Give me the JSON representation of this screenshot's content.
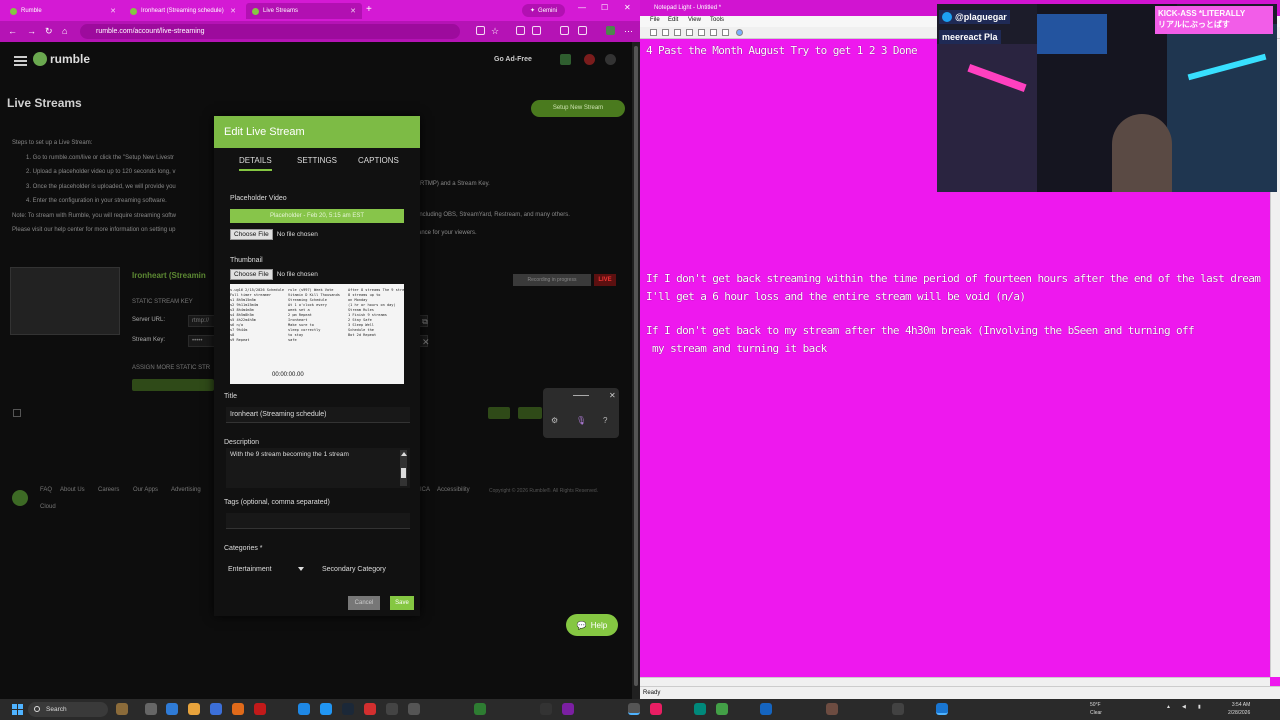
{
  "browser": {
    "tabs": [
      {
        "label": "Rumble"
      },
      {
        "label": "Ironheart (Streaming schedule)"
      },
      {
        "label": "Live Streams"
      }
    ],
    "gemini_label": "Gemini",
    "url": "rumble.com/account/live-streaming"
  },
  "site": {
    "logo_text": "rumble",
    "go_ad_free": "Go Ad-Free",
    "page_title": "Live Streams",
    "setup_button": "Setup New Stream",
    "steps": [
      "Steps to set up a Live Stream:",
      "1. Go to rumble.com/live or click the \"Setup New Livestr",
      "2. Upload a placeholder video up to 120 seconds long, v",
      "3. Once the placeholder is uploaded, we will provide you",
      "4. Enter the configuration in your streaming software.",
      "Note: To stream with Rumble, you will require streaming softw",
      "Please visit our help center for more information on setting up"
    ],
    "steps_right": [
      "(RTMP) and a Stream Key.",
      "including OBS, StreamYard, Restream, and many others.",
      "ance for your viewers."
    ],
    "stream_name": "Ironheart (Streamin",
    "recording_label": "Recording in progress",
    "live_badge": "LIVE",
    "static_key_label": "STATIC STREAM KEY",
    "server_url_label": "Server URL:",
    "server_url_value": "rtmp://",
    "stream_key_label": "Stream Key:",
    "stream_key_value": "•••••",
    "assign_label": "ASSIGN MORE STATIC STR",
    "footer_links": [
      "FAQ",
      "About Us",
      "Careers",
      "Our Apps",
      "Advertising",
      "Cloud"
    ],
    "footer_right_links": [
      "ICA",
      "Accessibility"
    ],
    "copyright": "Copyright © 2026 Rumble®. All Rights Reserved.",
    "help_label": "Help"
  },
  "modal": {
    "title": "Edit Live Stream",
    "tabs": [
      "DETAILS",
      "SETTINGS",
      "CAPTIONS"
    ],
    "placeholder_label": "Placeholder Video",
    "placeholder_value": "Placeholder - Feb 20, 5:15 am EST",
    "choose_file": "Choose File",
    "no_file": "No file chosen",
    "thumbnail_label": "Thumbnail",
    "thumbnail_timestamp": "00:00:00.00",
    "title_label": "Title",
    "title_value": "Ironheart (Streaming schedule)",
    "description_label": "Description",
    "description_value": "With the 9 stream becoming the 1 stream",
    "tags_label": "Tags (optional, comma separated)",
    "categories_label": "Categories *",
    "category_primary": "Entertainment",
    "category_secondary": "Secondary Category",
    "cancel": "Cancel",
    "save": "Save"
  },
  "notepad": {
    "title": "Notepad Light - Untitled *",
    "menu": [
      "File",
      "Edit",
      "View",
      "Tools"
    ],
    "lines": [
      "4 Past the Month August Try to get 1 2 3 Done",
      "If I don't get back streaming within the time period of fourteen hours after the end of the last dream",
      "I'll get a 6 hour loss and the entire stream will be void (n/a)",
      "If I don't get back to my stream after the 4h30m break (Involving the bSeen and turning off",
      " my stream and turning it back"
    ],
    "status": "Ready"
  },
  "overlay": {
    "twitter_handle": "@plaguegar",
    "twitter_line2": "meereact Pla",
    "kick_text_1": "KICK-ASS *LITERALLY",
    "kick_text_2": "リアルにぶっとばす"
  },
  "taskbar": {
    "search_placeholder": "Search",
    "weather_temp": "50°F",
    "weather_desc": "Clear",
    "time": "3:54 AM",
    "date": "2/28/2026"
  },
  "colors": {
    "rumble_green": "#85c742",
    "magenta_bg": "#ee18ee",
    "browser_tab_magenta": "#d41ad4"
  }
}
